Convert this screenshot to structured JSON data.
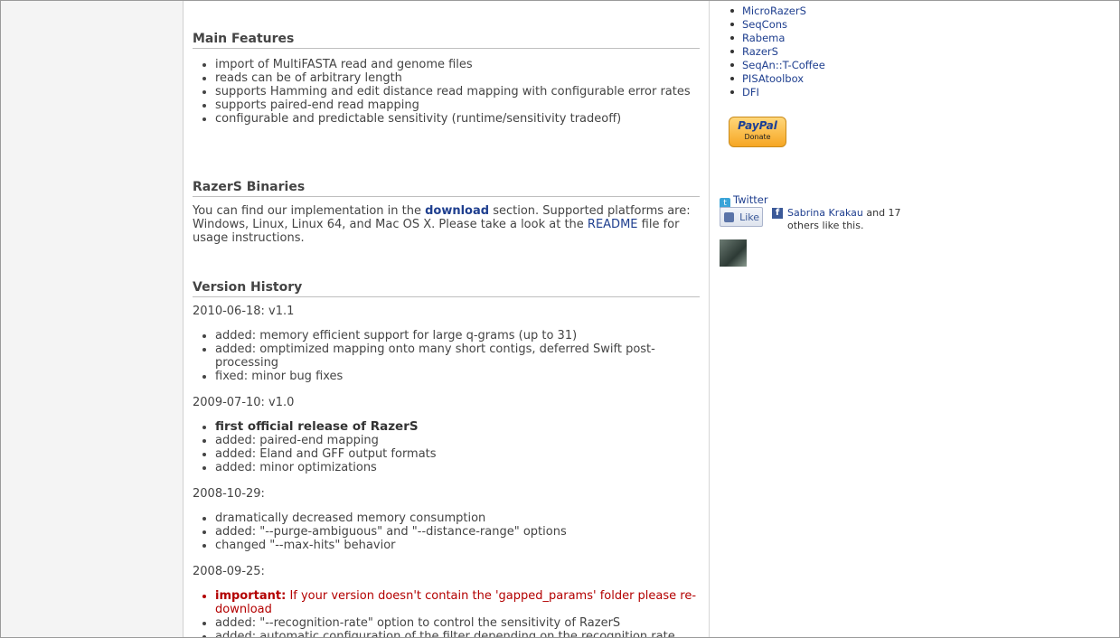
{
  "main_features": {
    "heading": "Main Features",
    "items": [
      "import of MultiFASTA read and genome files",
      "reads can be of arbitrary length",
      "supports Hamming and edit distance read mapping with configurable error rates",
      "supports paired-end read mapping",
      "configurable and predictable sensitivity (runtime/sensitivity tradeoff)"
    ]
  },
  "binaries": {
    "heading": "RazerS Binaries",
    "text_before": "You can find our implementation in the ",
    "download_link": "download",
    "text_middle": " section. Supported platforms are: Windows, Linux, Linux 64, and Mac OS X. Please take a look at the ",
    "readme_link": "README",
    "text_after": " file for usage instructions."
  },
  "history": {
    "heading": "Version History",
    "v1": {
      "date": "2010-06-18: v1.1",
      "items": [
        "added: memory efficient support for large q-grams (up to 31)",
        "added: omptimized mapping onto many short contigs, deferred Swift post-processing",
        "fixed: minor bug fixes"
      ]
    },
    "v2": {
      "date": "2009-07-10: v1.0",
      "bold_item": "first official release of RazerS",
      "items": [
        "added: paired-end mapping",
        "added: Eland and GFF output formats",
        "added: minor optimizations"
      ]
    },
    "v3": {
      "date": "2008-10-29:",
      "items": [
        "dramatically decreased memory consumption",
        "added: \"--purge-ambiguous\" and \"--distance-range\" options",
        "changed \"--max-hits\" behavior"
      ]
    },
    "v4": {
      "date": "2008-09-25:",
      "important_label": "important:",
      "important_text": " If your version doesn't contain the 'gapped_params' folder please re-download",
      "items": [
        "added: \"--recognition-rate\" option to control the sensitivity of RazerS",
        "added: automatic configuration of the filter depending on the recognition rate"
      ]
    }
  },
  "sidebar": {
    "links": [
      "MicroRazerS",
      "SeqCons",
      "Rabema",
      "RazerS",
      "SeqAn::T-Coffee",
      "PISAtoolbox",
      "DFI"
    ],
    "paypal_logo": "PayPal",
    "paypal_donate": "Donate",
    "twitter_label": "Twitter",
    "like_label": "Like",
    "like_name": "Sabrina Krakau",
    "like_rest": " and 17 others like this."
  },
  "colors": {
    "link": "#1f3f8f",
    "important": "#b30000"
  }
}
